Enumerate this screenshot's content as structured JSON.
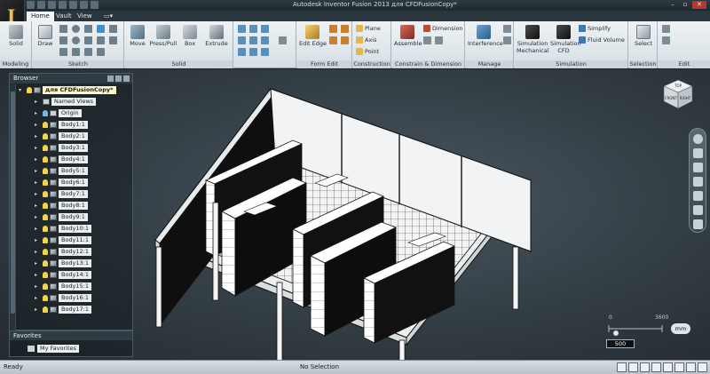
{
  "app": {
    "title": "Autodesk Inventor Fusion 2013   для CFDFusionCopy*",
    "logo_letter": "I"
  },
  "tabs": [
    {
      "label": "Home",
      "active": true
    },
    {
      "label": "Vault",
      "active": false
    },
    {
      "label": "View",
      "active": false
    }
  ],
  "ribbon": {
    "groups": {
      "modeling": "Modeling",
      "sketch": "Sketch",
      "solid": "Solid",
      "form_edit": "Form Edit",
      "construction": "Construction",
      "constrain": "Constrain & Dimension",
      "manage": "Manage",
      "simulation": "Simulation",
      "selection": "Selection",
      "edit": "Edit"
    },
    "buttons": {
      "solid": "Solid",
      "draw": "Draw",
      "move": "Move",
      "press_pull": "Press/Pull",
      "box": "Box",
      "extrude": "Extrude",
      "edit_edge": "Edit Edge",
      "plane": "Plane",
      "axis": "Axis",
      "point": "Point",
      "assemble": "Assemble",
      "dimension": "Dimension",
      "interference": "Interference",
      "sim_mech_1": "Simulation",
      "sim_mech_2": "Mechanical",
      "sim_cfd_1": "Simulation",
      "sim_cfd_2": "CFD",
      "simplify": "Simplify",
      "fluid_volume": "Fluid Volume",
      "select": "Select"
    }
  },
  "browser": {
    "title": "Browser",
    "root": "для CFDFusionCopy*",
    "items": [
      {
        "label": "Named Views",
        "type": "folder"
      },
      {
        "label": "Origin",
        "type": "folder"
      },
      {
        "label": "Body1:1",
        "type": "body"
      },
      {
        "label": "Body2:1",
        "type": "body"
      },
      {
        "label": "Body3:1",
        "type": "body"
      },
      {
        "label": "Body4:1",
        "type": "body"
      },
      {
        "label": "Body5:1",
        "type": "body"
      },
      {
        "label": "Body6:1",
        "type": "body"
      },
      {
        "label": "Body7:1",
        "type": "body"
      },
      {
        "label": "Body8:1",
        "type": "body"
      },
      {
        "label": "Body9:1",
        "type": "body"
      },
      {
        "label": "Body10:1",
        "type": "body"
      },
      {
        "label": "Body11:1",
        "type": "body"
      },
      {
        "label": "Body12:1",
        "type": "body"
      },
      {
        "label": "Body13:1",
        "type": "body"
      },
      {
        "label": "Body14:1",
        "type": "body"
      },
      {
        "label": "Body15:1",
        "type": "body"
      },
      {
        "label": "Body16:1",
        "type": "body"
      },
      {
        "label": "Body17:1",
        "type": "body"
      }
    ]
  },
  "favorites": {
    "title": "Favorites",
    "item": "My Favorites"
  },
  "viewcube": {
    "top": "TOP",
    "front": "FRONT",
    "right": "RIGHT"
  },
  "scale": {
    "min": "0",
    "max": "3600",
    "value": "500",
    "unit": "mm"
  },
  "status": {
    "left": "Ready",
    "center": "No Selection"
  }
}
